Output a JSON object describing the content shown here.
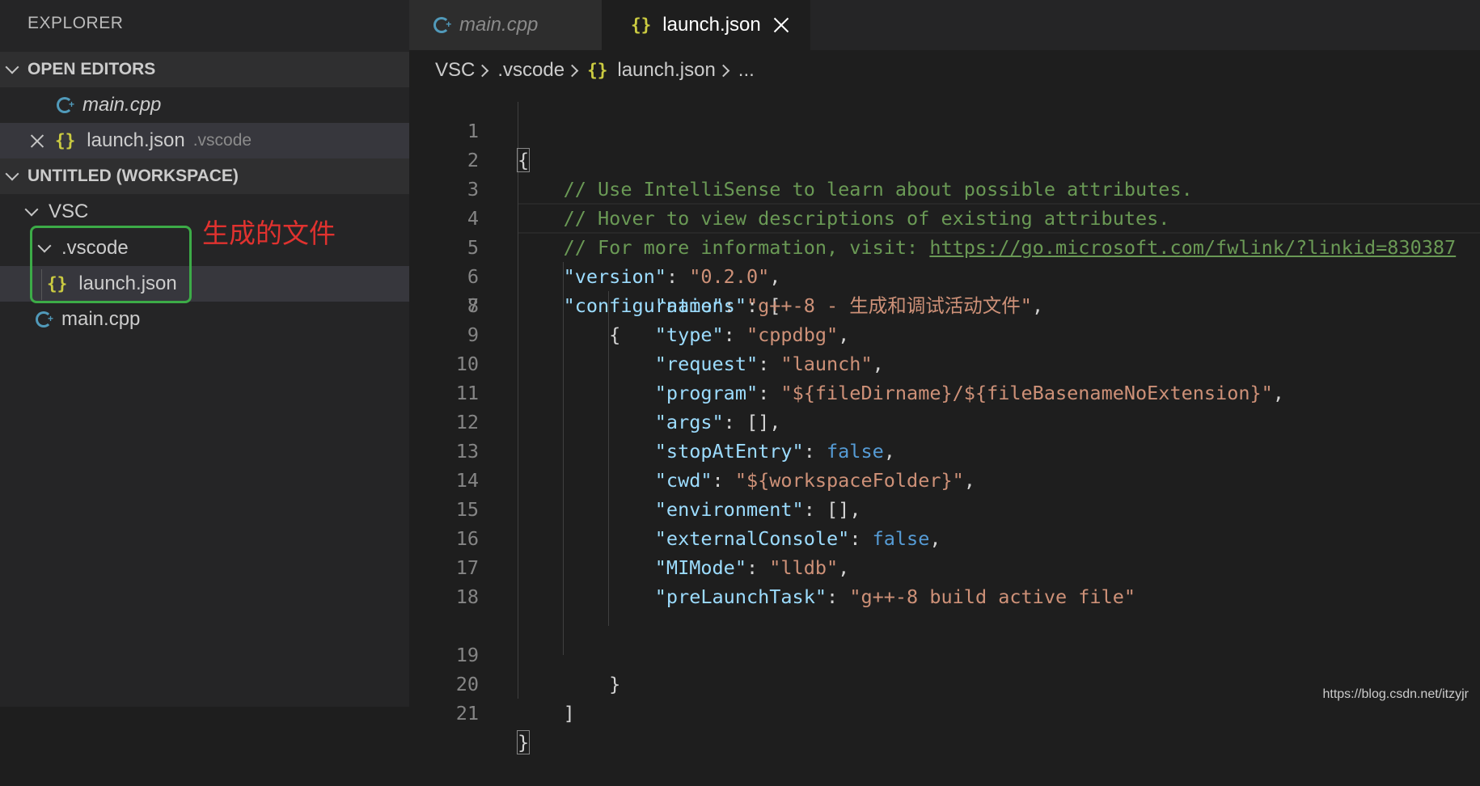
{
  "sidebar": {
    "title": "EXPLORER",
    "open_editors": {
      "header": "OPEN EDITORS",
      "items": [
        {
          "label": "main.cpp"
        },
        {
          "label": "launch.json",
          "path": ".vscode"
        }
      ]
    },
    "workspace": {
      "header": "UNTITLED (WORKSPACE)",
      "root": "VSC",
      "folder": ".vscode",
      "folder_file": "launch.json",
      "file": "main.cpp"
    },
    "annotation": "生成的文件"
  },
  "tabs": [
    {
      "label": "main.cpp",
      "active": false
    },
    {
      "label": "launch.json",
      "active": true
    }
  ],
  "breadcrumbs": {
    "items": [
      "VSC",
      ".vscode",
      "launch.json",
      "..."
    ]
  },
  "editor": {
    "lines": [
      {
        "n": "1"
      },
      {
        "n": "2"
      },
      {
        "n": "3"
      },
      {
        "n": "4"
      },
      {
        "n": "5"
      },
      {
        "n": "6"
      },
      {
        "n": "7"
      },
      {
        "n": "8"
      },
      {
        "n": "9"
      },
      {
        "n": "10"
      },
      {
        "n": "11"
      },
      {
        "n": "12"
      },
      {
        "n": "13"
      },
      {
        "n": "14"
      },
      {
        "n": "15"
      },
      {
        "n": "16"
      },
      {
        "n": "17"
      },
      {
        "n": "18"
      },
      {
        "n": "19"
      },
      {
        "n": "20"
      },
      {
        "n": "21"
      }
    ],
    "comments": [
      "// Use IntelliSense to learn about possible attributes.",
      "// Hover to view descriptions of existing attributes.",
      "// For more information, visit: "
    ],
    "link": "https://go.microsoft.com/fwlink/?linkid=830387",
    "version_key": "\"version\"",
    "version_val": "\"0.2.0\"",
    "configurations_key": "\"configurations\"",
    "config": [
      {
        "key": "\"name\"",
        "val": "\"g++-8 - 生成和调试活动文件\"",
        "kind": "str",
        "trail": ","
      },
      {
        "key": "\"type\"",
        "val": "\"cppdbg\"",
        "kind": "str",
        "trail": ","
      },
      {
        "key": "\"request\"",
        "val": "\"launch\"",
        "kind": "str",
        "trail": ","
      },
      {
        "key": "\"program\"",
        "val": "\"${fileDirname}/${fileBasenameNoExtension}\"",
        "kind": "str",
        "trail": ","
      },
      {
        "key": "\"args\"",
        "val": "[]",
        "kind": "plain",
        "trail": ","
      },
      {
        "key": "\"stopAtEntry\"",
        "val": "false",
        "kind": "kw",
        "trail": ","
      },
      {
        "key": "\"cwd\"",
        "val": "\"${workspaceFolder}\"",
        "kind": "str",
        "trail": ","
      },
      {
        "key": "\"environment\"",
        "val": "[]",
        "kind": "plain",
        "trail": ","
      },
      {
        "key": "\"externalConsole\"",
        "val": "false",
        "kind": "kw",
        "trail": ","
      },
      {
        "key": "\"MIMode\"",
        "val": "\"lldb\"",
        "kind": "str",
        "trail": ","
      },
      {
        "key": "\"preLaunchTask\"",
        "val": "\"g++-8 build active file\"",
        "kind": "str",
        "trail": ""
      }
    ]
  },
  "watermark": "https://blog.csdn.net/itzyjr"
}
